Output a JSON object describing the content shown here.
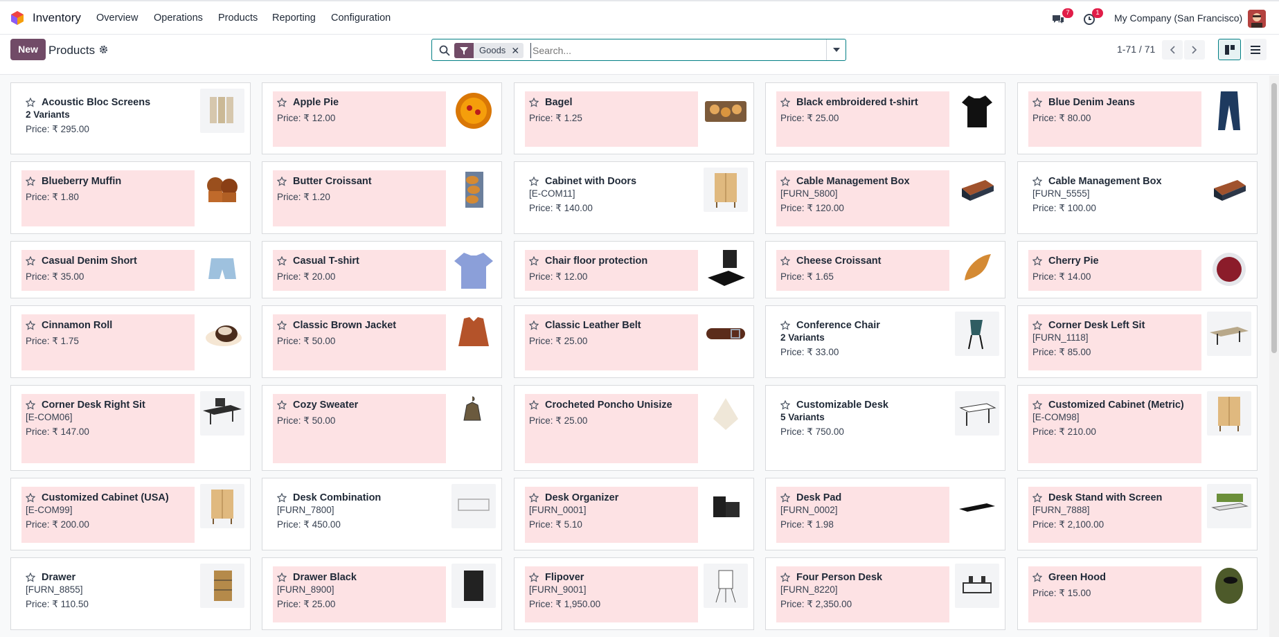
{
  "navbar": {
    "app_name": "Inventory",
    "menu": [
      "Overview",
      "Operations",
      "Products",
      "Reporting",
      "Configuration"
    ],
    "messages_badge": "7",
    "activities_badge": "1",
    "company": "My Company (San Francisco)"
  },
  "control_panel": {
    "new_label": "New",
    "title": "Products",
    "facet_value": "Goods",
    "search_placeholder": "Search...",
    "pager": "1-71 / 71"
  },
  "colors": {
    "brand": "#714b67",
    "accent": "#017e84",
    "highlight": "#fde2e4"
  },
  "products": [
    {
      "name": "Acoustic Bloc Screens",
      "sub": "2 Variants",
      "sub_type": "variants",
      "price": "Price: ₹ 295.00",
      "highlight": false,
      "icon": "screen-icon"
    },
    {
      "name": "Apple Pie",
      "sub": "",
      "sub_type": "",
      "price": "Price: ₹ 12.00",
      "highlight": true,
      "icon": "pie-icon"
    },
    {
      "name": "Bagel",
      "sub": "",
      "sub_type": "",
      "price": "Price: ₹ 1.25",
      "highlight": true,
      "icon": "bagel-icon"
    },
    {
      "name": "Black embroidered t-shirt",
      "sub": "",
      "sub_type": "",
      "price": "Price: ₹ 25.00",
      "highlight": true,
      "icon": "tshirt-black-icon"
    },
    {
      "name": "Blue Denim Jeans",
      "sub": "",
      "sub_type": "",
      "price": "Price: ₹ 80.00",
      "highlight": true,
      "icon": "jeans-icon"
    },
    {
      "name": "Blueberry Muffin",
      "sub": "",
      "sub_type": "",
      "price": "Price: ₹ 1.80",
      "highlight": true,
      "icon": "muffin-icon"
    },
    {
      "name": "Butter Croissant",
      "sub": "",
      "sub_type": "",
      "price": "Price: ₹ 1.20",
      "highlight": true,
      "icon": "croissant-bag-icon"
    },
    {
      "name": "Cabinet with Doors",
      "sub": "[E-COM11]",
      "sub_type": "ref",
      "price": "Price: ₹ 140.00",
      "highlight": false,
      "icon": "cabinet-icon"
    },
    {
      "name": "Cable Management Box",
      "sub": "[FURN_5800]",
      "sub_type": "ref",
      "price": "Price: ₹ 120.00",
      "highlight": true,
      "icon": "cable-box-icon"
    },
    {
      "name": "Cable Management Box",
      "sub": "[FURN_5555]",
      "sub_type": "ref",
      "price": "Price: ₹ 100.00",
      "highlight": false,
      "icon": "cable-box-icon"
    },
    {
      "name": "Casual Denim Short",
      "sub": "",
      "sub_type": "",
      "price": "Price: ₹ 35.00",
      "highlight": true,
      "icon": "shorts-icon"
    },
    {
      "name": "Casual T-shirt",
      "sub": "",
      "sub_type": "",
      "price": "Price: ₹ 20.00",
      "highlight": true,
      "icon": "tshirt-blue-icon"
    },
    {
      "name": "Chair floor protection",
      "sub": "",
      "sub_type": "",
      "price": "Price: ₹ 12.00",
      "highlight": true,
      "icon": "floor-mat-icon"
    },
    {
      "name": "Cheese Croissant",
      "sub": "",
      "sub_type": "",
      "price": "Price: ₹ 1.65",
      "highlight": true,
      "icon": "croissant-icon"
    },
    {
      "name": "Cherry Pie",
      "sub": "",
      "sub_type": "",
      "price": "Price: ₹ 14.00",
      "highlight": true,
      "icon": "cherry-pie-icon"
    },
    {
      "name": "Cinnamon Roll",
      "sub": "",
      "sub_type": "",
      "price": "Price: ₹ 1.75",
      "highlight": true,
      "icon": "cinnamon-roll-icon"
    },
    {
      "name": "Classic Brown Jacket",
      "sub": "",
      "sub_type": "",
      "price": "Price: ₹ 50.00",
      "highlight": true,
      "icon": "jacket-icon"
    },
    {
      "name": "Classic Leather Belt",
      "sub": "",
      "sub_type": "",
      "price": "Price: ₹ 25.00",
      "highlight": true,
      "icon": "belt-icon"
    },
    {
      "name": "Conference Chair",
      "sub": "2 Variants",
      "sub_type": "variants",
      "price": "Price: ₹ 33.00",
      "highlight": false,
      "icon": "chair-icon"
    },
    {
      "name": "Corner Desk Left Sit",
      "sub": "[FURN_1118]",
      "sub_type": "ref",
      "price": "Price: ₹ 85.00",
      "highlight": true,
      "icon": "desk-icon"
    },
    {
      "name": "Corner Desk Right Sit",
      "sub": "[E-COM06]",
      "sub_type": "ref",
      "price": "Price: ₹ 147.00",
      "highlight": true,
      "icon": "desk-dark-icon"
    },
    {
      "name": "Cozy Sweater",
      "sub": "",
      "sub_type": "",
      "price": "Price: ₹ 50.00",
      "highlight": true,
      "icon": "sweater-icon"
    },
    {
      "name": "Crocheted Poncho Unisize",
      "sub": "",
      "sub_type": "",
      "price": "Price: ₹ 25.00",
      "highlight": true,
      "icon": "poncho-icon"
    },
    {
      "name": "Customizable Desk",
      "sub": "5 Variants",
      "sub_type": "variants",
      "price": "Price: ₹ 750.00",
      "highlight": false,
      "icon": "table-icon"
    },
    {
      "name": "Customized Cabinet (Metric)",
      "sub": "[E-COM98]",
      "sub_type": "ref",
      "price": "Price: ₹ 210.00",
      "highlight": true,
      "icon": "cabinet-icon"
    },
    {
      "name": "Customized Cabinet (USA)",
      "sub": "[E-COM99]",
      "sub_type": "ref",
      "price": "Price: ₹ 200.00",
      "highlight": true,
      "icon": "cabinet-icon"
    },
    {
      "name": "Desk Combination",
      "sub": "[FURN_7800]",
      "sub_type": "ref",
      "price": "Price: ₹ 450.00",
      "highlight": false,
      "icon": "desk-combo-icon"
    },
    {
      "name": "Desk Organizer",
      "sub": "[FURN_0001]",
      "sub_type": "ref",
      "price": "Price: ₹ 5.10",
      "highlight": true,
      "icon": "organizer-icon"
    },
    {
      "name": "Desk Pad",
      "sub": "[FURN_0002]",
      "sub_type": "ref",
      "price": "Price: ₹ 1.98",
      "highlight": true,
      "icon": "desk-pad-icon"
    },
    {
      "name": "Desk Stand with Screen",
      "sub": "[FURN_7888]",
      "sub_type": "ref",
      "price": "Price: ₹ 2,100.00",
      "highlight": true,
      "icon": "desk-screen-icon"
    },
    {
      "name": "Drawer",
      "sub": "[FURN_8855]",
      "sub_type": "ref",
      "price": "Price: ₹ 110.50",
      "highlight": false,
      "icon": "drawer-icon"
    },
    {
      "name": "Drawer Black",
      "sub": "[FURN_8900]",
      "sub_type": "ref",
      "price": "Price: ₹ 25.00",
      "highlight": true,
      "icon": "drawer-black-icon"
    },
    {
      "name": "Flipover",
      "sub": "[FURN_9001]",
      "sub_type": "ref",
      "price": "Price: ₹ 1,950.00",
      "highlight": true,
      "icon": "flipover-icon"
    },
    {
      "name": "Four Person Desk",
      "sub": "[FURN_8220]",
      "sub_type": "ref",
      "price": "Price: ₹ 2,350.00",
      "highlight": true,
      "icon": "four-desk-icon"
    },
    {
      "name": "Green Hood",
      "sub": "",
      "sub_type": "",
      "price": "Price: ₹ 15.00",
      "highlight": true,
      "icon": "hood-icon"
    }
  ]
}
